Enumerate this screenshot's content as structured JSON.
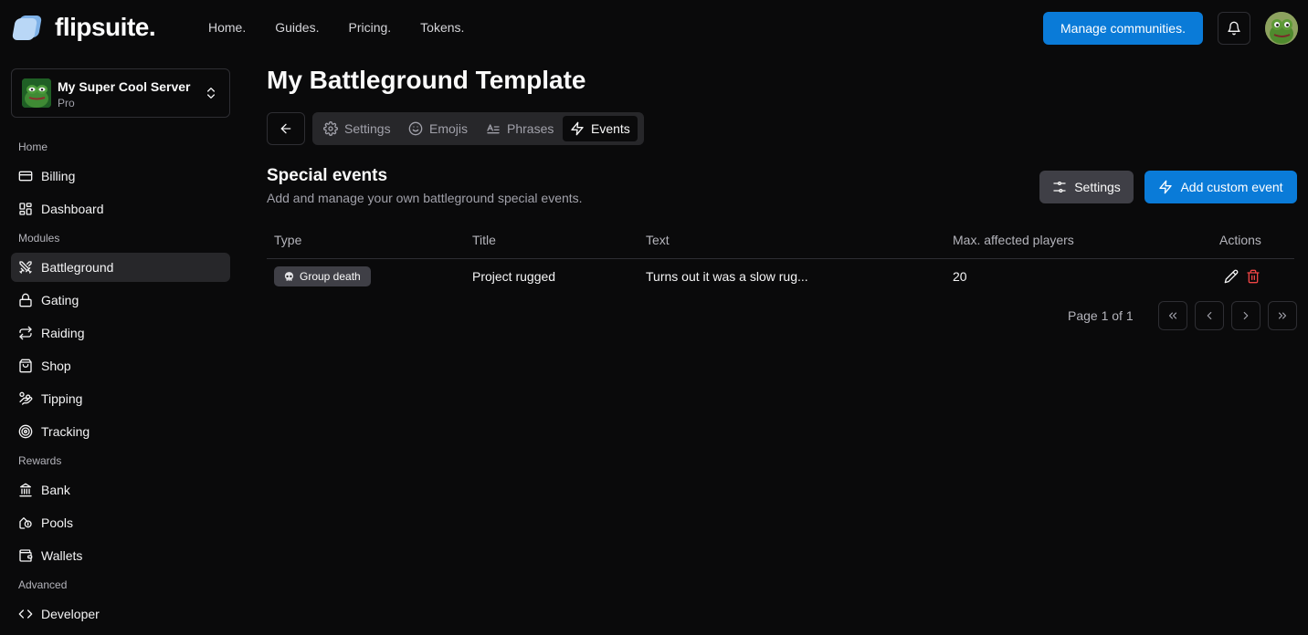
{
  "brand": {
    "name": "flipsuite."
  },
  "topnav": [
    "Home.",
    "Guides.",
    "Pricing.",
    "Tokens."
  ],
  "header": {
    "manage_label": "Manage communities."
  },
  "server": {
    "name": "My Super Cool Server",
    "plan": "Pro"
  },
  "sidebar": {
    "sections": {
      "home": "Home",
      "modules": "Modules",
      "rewards": "Rewards",
      "advanced": "Advanced"
    },
    "items": [
      {
        "label": "Billing",
        "icon": "credit-card-icon"
      },
      {
        "label": "Dashboard",
        "icon": "dashboard-icon"
      },
      {
        "label": "Battleground",
        "icon": "swords-icon",
        "active": true
      },
      {
        "label": "Gating",
        "icon": "lock-icon"
      },
      {
        "label": "Raiding",
        "icon": "repeat-icon"
      },
      {
        "label": "Shop",
        "icon": "shopping-bag-icon"
      },
      {
        "label": "Tipping",
        "icon": "hand-coins-icon"
      },
      {
        "label": "Tracking",
        "icon": "target-icon"
      },
      {
        "label": "Bank",
        "icon": "bank-icon"
      },
      {
        "label": "Pools",
        "icon": "coins-icon"
      },
      {
        "label": "Wallets",
        "icon": "wallet-icon"
      },
      {
        "label": "Developer",
        "icon": "code-icon"
      }
    ]
  },
  "page": {
    "title": "My Battleground Template"
  },
  "tabs": [
    {
      "label": "Settings",
      "icon": "gear-icon"
    },
    {
      "label": "Emojis",
      "icon": "smile-icon"
    },
    {
      "label": "Phrases",
      "icon": "text-icon"
    },
    {
      "label": "Events",
      "icon": "zap-icon",
      "active": true
    }
  ],
  "events": {
    "title": "Special events",
    "description": "Add and manage your own battleground special events.",
    "settings_label": "Settings",
    "add_label": "Add custom event",
    "columns": [
      "Type",
      "Title",
      "Text",
      "Max. affected players",
      "Actions"
    ],
    "rows": [
      {
        "type": "Group death",
        "type_icon": "skull-icon",
        "title": "Project rugged",
        "text": "Turns out it was a slow rug...",
        "max_players": "20"
      }
    ],
    "pagination": {
      "text": "Page 1 of 1"
    }
  },
  "colors": {
    "accent": "#0a7bd8",
    "background": "#0a0a0b",
    "danger": "#ef4444"
  }
}
